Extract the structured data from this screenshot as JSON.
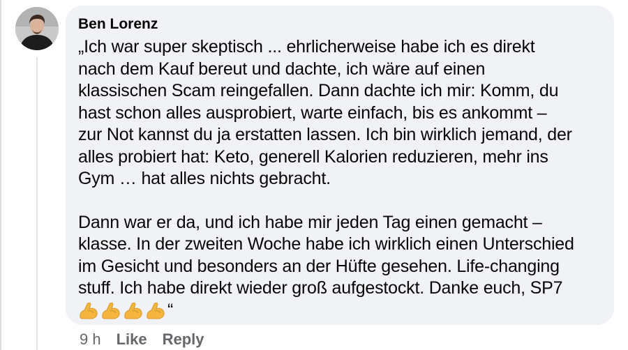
{
  "comment": {
    "author": "Ben Lorenz",
    "paragraphs": [
      "„Ich war super skeptisch ... ehrlicherweise habe ich es direkt\nnach dem Kauf bereut und dachte, ich wäre auf einen\nklassischen Scam reingefallen. Dann dachte ich mir: Komm, du\nhast schon alles ausprobiert, warte einfach, bis es ankommt –\nzur Not kannst du ja erstatten lassen. Ich bin wirklich jemand, der\nalles probiert hat: Keto, generell Kalorien reduzieren, mehr ins\nGym … hat alles nichts gebracht.",
      "Dann war er da, und ich habe mir jeden Tag einen gemacht –\nklasse. In der zweiten Woche habe ich wirklich einen Unterschied\nim Gesicht und besonders an der Hüfte gesehen. Life-changing\nstuff. Ich habe direkt wieder groß aufgestockt. Danke euch, SP7"
    ],
    "closing_quote": "“",
    "emoji_icon": "flexed-biceps",
    "emoji_count": 4
  },
  "meta": {
    "time": "9 h",
    "like_label": "Like",
    "reply_label": "Reply"
  }
}
